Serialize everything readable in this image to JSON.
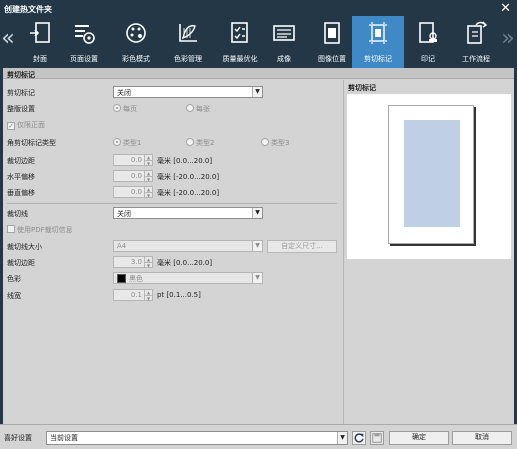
{
  "window": {
    "title": "创建热文件夹"
  },
  "toolbar": {
    "items": [
      {
        "label": "封面",
        "icon": "cover-icon"
      },
      {
        "label": "页面设置",
        "icon": "page-setup-icon"
      },
      {
        "label": "彩色模式",
        "icon": "color-mode-icon"
      },
      {
        "label": "色彩管理",
        "icon": "color-management-icon"
      },
      {
        "label": "质量最优化",
        "icon": "quality-icon"
      },
      {
        "label": "成像",
        "icon": "imaging-icon"
      },
      {
        "label": "图像位置",
        "icon": "image-position-icon"
      },
      {
        "label": "剪切标记",
        "icon": "crop-marks-icon"
      },
      {
        "label": "印记",
        "icon": "stamp-icon"
      },
      {
        "label": "工作流程",
        "icon": "workflow-icon"
      }
    ],
    "active_index": 7,
    "active_color": "#3f89c7"
  },
  "section": {
    "title": "剪切标记"
  },
  "form": {
    "crop_marks": {
      "label": "剪切标记",
      "value": "关闭"
    },
    "layout": {
      "label": "整版设置",
      "opt1": "每页",
      "opt2": "每张"
    },
    "front_only": {
      "label": "仅限正面"
    },
    "corner_type": {
      "label": "角剪切标记类型",
      "opt1": "类型1",
      "opt2": "类型2",
      "opt3": "类型3"
    },
    "crop_margin": {
      "label": "裁切边距",
      "value": "0.0",
      "unit": "毫米 [0.0...20.0]"
    },
    "h_offset": {
      "label": "水平偏移",
      "value": "0.0",
      "unit": "毫米 [-20.0...20.0]"
    },
    "v_offset": {
      "label": "垂直偏移",
      "value": "0.0",
      "unit": "毫米 [-20.0...20.0]"
    },
    "cut_line": {
      "label": "裁切线",
      "value": "关闭"
    },
    "use_pdf": {
      "label": "使用PDF裁切信息"
    },
    "cut_line_size": {
      "label": "裁切线大小",
      "value": "A4",
      "custom_button": "自定义尺寸..."
    },
    "cut_margin": {
      "label": "裁切边距",
      "value": "3.0",
      "unit": "毫米 [0.0...20.0]"
    },
    "color": {
      "label": "色彩",
      "value": "黑色",
      "swatch": "#000000"
    },
    "line_width": {
      "label": "线宽",
      "value": "0.1",
      "unit": "pt [0.1...0.5]"
    }
  },
  "preview": {
    "label": "剪切标记",
    "area_color": "#bfcfe6"
  },
  "bottom": {
    "pref_label": "喜好设置",
    "pref_value": "当前设置",
    "ok_label": "确定",
    "cancel_label": "取消"
  }
}
